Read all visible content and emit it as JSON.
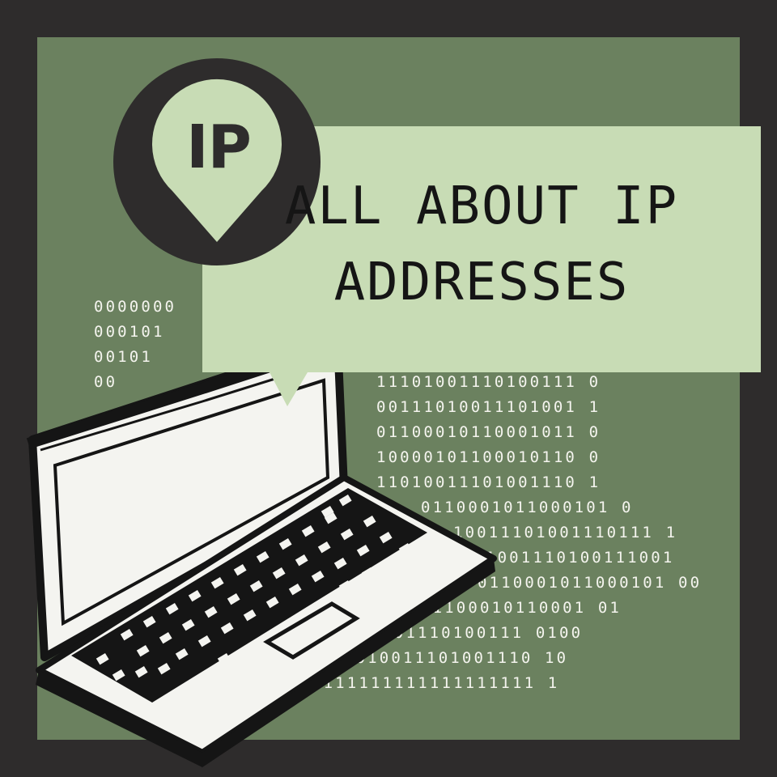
{
  "badge": {
    "label": "IP"
  },
  "title": {
    "line1": "ALL ABOUT IP",
    "line2": "ADDRESSES"
  },
  "binary": {
    "left_rows": [
      "0000000",
      "000101",
      "00101",
      "00"
    ],
    "right_rows": [
      "11101001110100111 0",
      "00111010011101001 1",
      "01100010110001011 0",
      "10000101100010110 0",
      "11010011101001110 1",
      "0110001011000101 0",
      "10011101001110111 1",
      "1001110100111001",
      "0110001011000101 00",
      "01100010110001 01",
      "01001110100111 0100",
      "1010011101001110 10",
      "1111111111111111111 1"
    ]
  },
  "colors": {
    "frame": "#2e2c2c",
    "panel": "#6b815f",
    "callout": "#c8dcb5",
    "ink": "#151515",
    "binary_text": "#f4f4ee"
  },
  "icons": {
    "badge": "map-pin-icon",
    "illustration": "laptop-icon"
  }
}
